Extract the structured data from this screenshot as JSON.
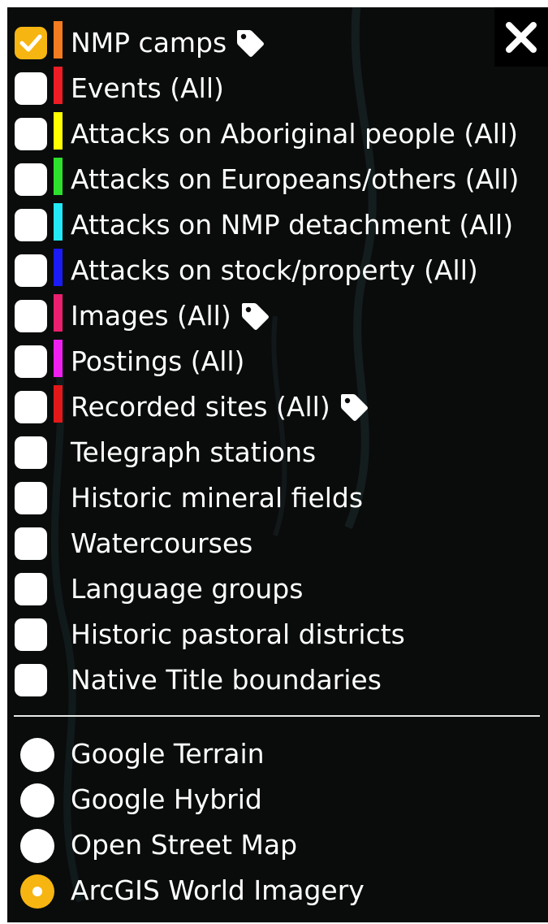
{
  "close_icon": "close-x-icon",
  "layers": [
    {
      "label": "NMP camps",
      "checked": true,
      "color": "#f47b20",
      "tag": true
    },
    {
      "label": "Events (All)",
      "checked": false,
      "color": "#ee1c24",
      "tag": false
    },
    {
      "label": "Attacks on Aboriginal people (All)",
      "checked": false,
      "color": "#ffff00",
      "tag": false
    },
    {
      "label": "Attacks on Europeans/others (All)",
      "checked": false,
      "color": "#2de02d",
      "tag": false
    },
    {
      "label": "Attacks on NMP detachment (All)",
      "checked": false,
      "color": "#23e8f5",
      "tag": false
    },
    {
      "label": "Attacks on stock/property (All)",
      "checked": false,
      "color": "#1b1bf5",
      "tag": false
    },
    {
      "label": "Images (All)",
      "checked": false,
      "color": "#ea1f6e",
      "tag": true
    },
    {
      "label": "Postings (All)",
      "checked": false,
      "color": "#ef1ff0",
      "tag": false
    },
    {
      "label": "Recorded sites (All)",
      "checked": false,
      "color": "#e41818",
      "tag": true
    },
    {
      "label": "Telegraph stations",
      "checked": false,
      "color": "",
      "tag": false
    },
    {
      "label": "Historic mineral fields",
      "checked": false,
      "color": "",
      "tag": false
    },
    {
      "label": "Watercourses",
      "checked": false,
      "color": "",
      "tag": false
    },
    {
      "label": "Language groups",
      "checked": false,
      "color": "",
      "tag": false
    },
    {
      "label": "Historic pastoral districts",
      "checked": false,
      "color": "",
      "tag": false
    },
    {
      "label": "Native Title boundaries",
      "checked": false,
      "color": "",
      "tag": false
    }
  ],
  "basemaps": [
    {
      "label": "Google Terrain",
      "selected": false
    },
    {
      "label": "Google Hybrid",
      "selected": false
    },
    {
      "label": "Open Street Map",
      "selected": false
    },
    {
      "label": "ArcGIS World Imagery",
      "selected": true
    }
  ],
  "colors": {
    "panel_background": "#0a0c0c",
    "accent": "#f7b512",
    "text": "#ffffff"
  }
}
